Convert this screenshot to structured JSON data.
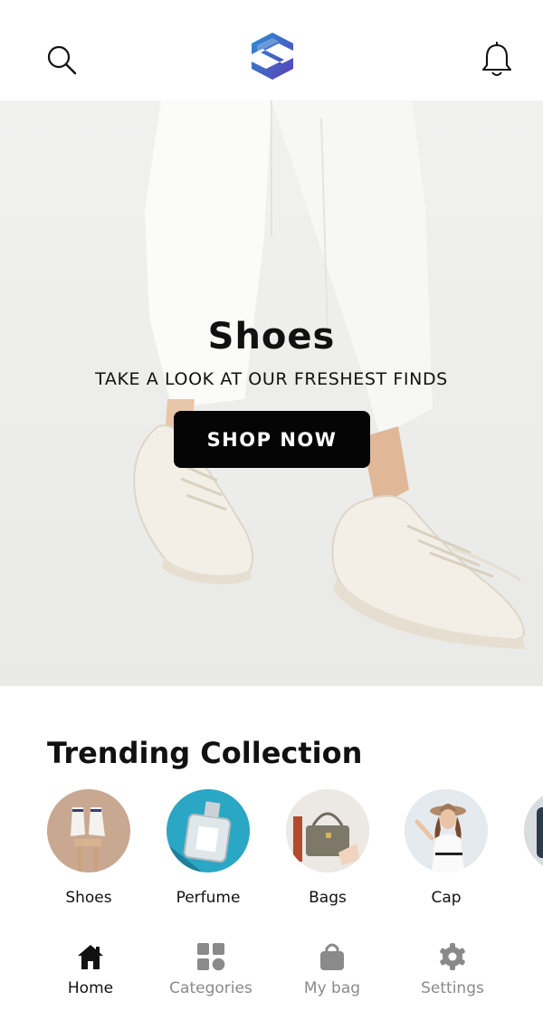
{
  "header": {
    "search_icon": "search-icon",
    "logo_icon": "brand-s-logo",
    "bell_icon": "bell-icon"
  },
  "hero": {
    "title": "Shoes",
    "subtitle": "TAKE A LOOK AT OUR FRESHEST FINDS",
    "cta_label": "SHOP NOW"
  },
  "trending": {
    "title": "Trending Collection",
    "items": [
      {
        "label": "Shoes"
      },
      {
        "label": "Perfume"
      },
      {
        "label": "Bags"
      },
      {
        "label": "Cap"
      },
      {
        "label": ""
      }
    ]
  },
  "nav": {
    "items": [
      {
        "label": "Home",
        "icon": "home-icon",
        "active": true
      },
      {
        "label": "Categories",
        "icon": "grid-icon",
        "active": false
      },
      {
        "label": "My bag",
        "icon": "bag-icon",
        "active": false
      },
      {
        "label": "Settings",
        "icon": "gear-icon",
        "active": false
      }
    ]
  },
  "colors": {
    "background": "#ffffff",
    "hero_background": "#efefee",
    "cta_background": "#050505",
    "logo_gradient_start": "#2a8fd6",
    "logo_gradient_end": "#5b3fb5",
    "inactive_nav": "#8a8a8a"
  }
}
